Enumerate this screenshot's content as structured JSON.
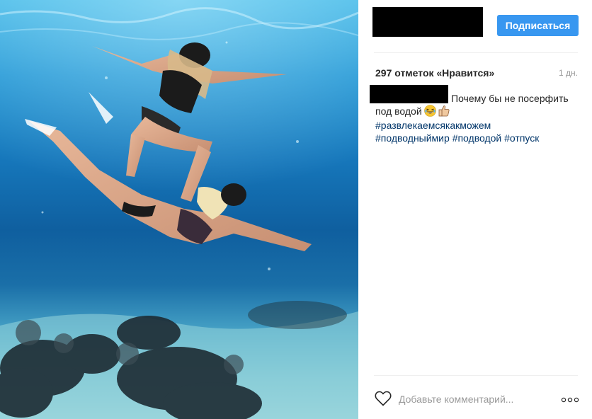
{
  "header": {
    "follow_label": "Подписаться"
  },
  "stats": {
    "likes_label": "297 отметок «Нравится»",
    "time_label": "1 дн."
  },
  "caption": {
    "line1": "Почему бы не посерфить",
    "line2": "под водой",
    "emojis": [
      "grinning-squinting-face-icon",
      "thumbs-up-icon"
    ]
  },
  "hashtags": [
    "#развлекаемсякакможем",
    "#подводныймир",
    "#подводой",
    "#отпуск"
  ],
  "comment": {
    "placeholder": "Добавьте комментарий..."
  },
  "colors": {
    "accent": "#3897f0",
    "hashtag": "#003569",
    "text": "#262626",
    "muted": "#999999"
  }
}
